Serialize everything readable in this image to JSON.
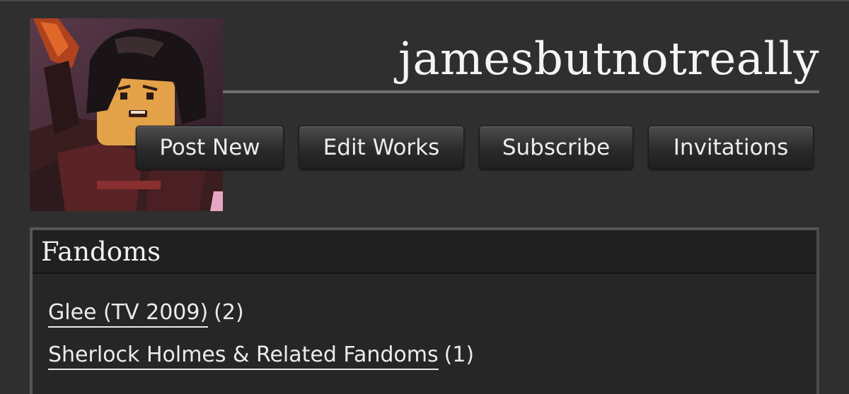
{
  "profile": {
    "username": "jamesbutnotreally",
    "avatar_icon": "lego-minifigure-avatar"
  },
  "actions": {
    "post_new": "Post New",
    "edit_works": "Edit Works",
    "subscribe": "Subscribe",
    "invitations": "Invitations"
  },
  "fandoms": {
    "title": "Fandoms",
    "items": [
      {
        "name": "Glee (TV 2009)",
        "count": "(2)"
      },
      {
        "name": "Sherlock Holmes & Related Fandoms",
        "count": "(1)"
      }
    ]
  },
  "colors": {
    "background": "#2f2f2f",
    "panel": "#262626",
    "text": "#e9e9e9"
  }
}
